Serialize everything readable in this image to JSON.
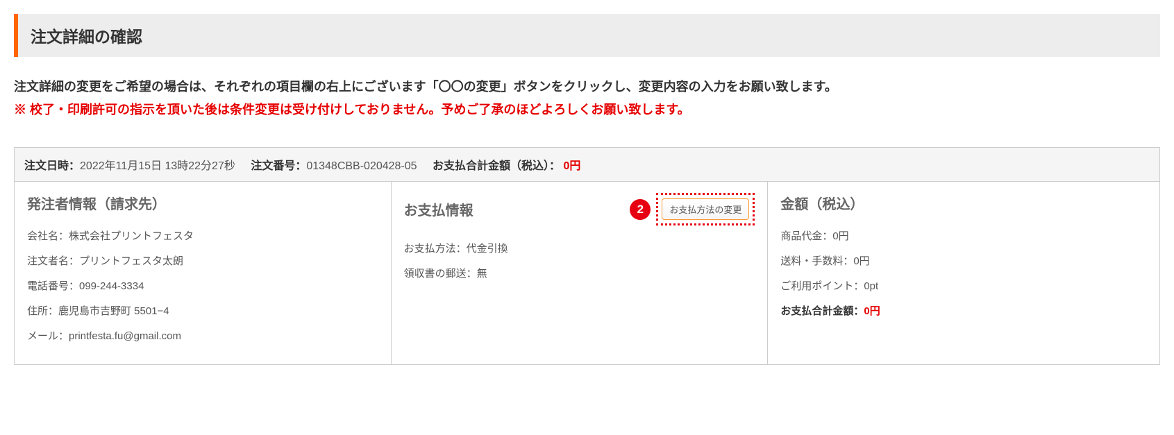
{
  "page_title": "注文詳細の確認",
  "instruction_text": "注文詳細の変更をご希望の場合は、それぞれの項目欄の右上にございます「〇〇の変更」ボタンをクリックし、変更内容の入力をお願い致します。",
  "warning_text": "※ 校了・印刷許可の指示を頂いた後は条件変更は受け付けしておりません。予めご了承のほどよろしくお願い致します。",
  "order_header": {
    "datetime_label": "注文日時：",
    "datetime_value": "2022年11月15日 13時22分27秒",
    "order_no_label": "注文番号：",
    "order_no_value": "01348CBB-020428-05",
    "total_label": "お支払合計金額（税込）：",
    "total_value": "0円"
  },
  "orderer": {
    "title": "発注者情報（請求先）",
    "lines": {
      "company": "会社名：株式会社プリントフェスタ",
      "name": "注文者名：プリントフェスタ太朗",
      "phone": "電話番号：099-244-3334",
      "address": "住所：鹿児島市吉野町 5501−4",
      "email": "メール：printfesta.fu@gmail.com"
    }
  },
  "payment": {
    "title": "お支払情報",
    "step_badge": "2",
    "change_button": "お支払方法の変更",
    "method": "お支払方法：代金引換",
    "receipt": "領収書の郵送：無"
  },
  "amount": {
    "title": "金額（税込）",
    "product": "商品代金：0円",
    "shipping": "送料・手数料：0円",
    "points": "ご利用ポイント：0pt",
    "total_label": "お支払合計金額：",
    "total_value": "0円"
  }
}
